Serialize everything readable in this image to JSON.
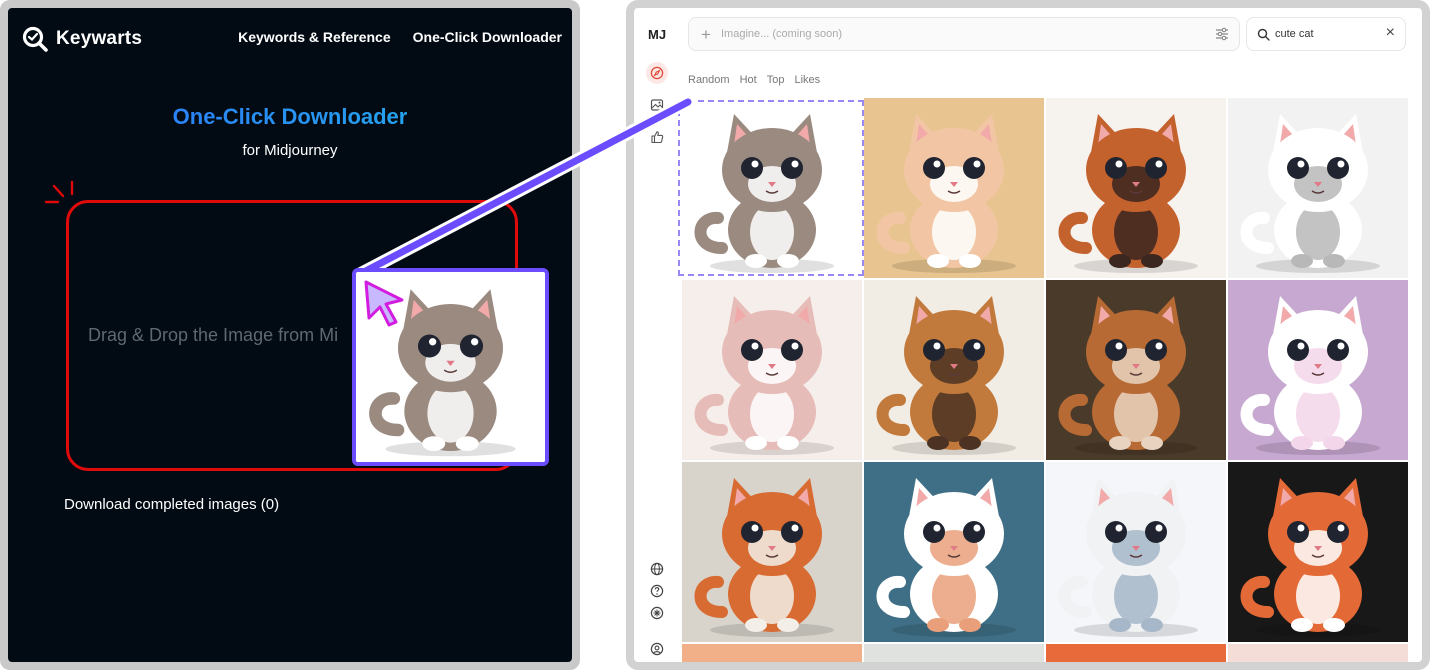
{
  "keywarts": {
    "brand": "Keywarts",
    "nav": [
      "Keywords & Reference",
      "One-Click Downloader"
    ],
    "title": "One-Click Downloader",
    "subtitle": "for Midjourney",
    "drop_text": "Drag & Drop the Image from Mi",
    "download_completed": "Download completed images (0)",
    "accent_gradient": [
      "#2f6dff",
      "#21b8e6"
    ],
    "drop_border_color": "#e10a0a",
    "drag_border_color": "#6b4dff"
  },
  "midjourney": {
    "logo": "MJ",
    "imagine_placeholder": "Imagine... (coming soon)",
    "search_value": "cute cat",
    "tabs": [
      "Random",
      "Hot",
      "Top",
      "Likes"
    ],
    "side_icons_top": [
      "compass-icon",
      "image-icon",
      "thumbs-up-icon"
    ],
    "side_icons_bottom": [
      "globe-icon",
      "help-icon",
      "sun-icon",
      "account-icon"
    ]
  },
  "gallery": {
    "tiles": [
      {
        "bg": "#ffffff",
        "fur": "#9a8a80",
        "accent": "#ffffff"
      },
      {
        "bg": "#e8c590",
        "fur": "#f2c6a4",
        "accent": "#ffffff"
      },
      {
        "bg": "#f6f2ee",
        "fur": "#c4622e",
        "accent": "#3b2620"
      },
      {
        "bg": "#f2f2f2",
        "fur": "#ffffff",
        "accent": "#b8b8b8"
      },
      {
        "bg": "#f6eeea",
        "fur": "#e6bcb8",
        "accent": "#ffffff"
      },
      {
        "bg": "#f1ece4",
        "fur": "#c27a3c",
        "accent": "#4b3222"
      },
      {
        "bg": "#4a3a2a",
        "fur": "#b86a34",
        "accent": "#e7d3c0"
      },
      {
        "bg": "#c6a8d0",
        "fur": "#ffffff",
        "accent": "#f3d6ea"
      },
      {
        "bg": "#d8d4cc",
        "fur": "#d86b32",
        "accent": "#f3efe8"
      },
      {
        "bg": "#3f6f86",
        "fur": "#ffffff",
        "accent": "#e9a07a"
      },
      {
        "bg": "#f4f6fa",
        "fur": "#f0f2f4",
        "accent": "#a5b7c8"
      },
      {
        "bg": "#181818",
        "fur": "#e36a36",
        "accent": "#ffffff"
      }
    ],
    "strip_colors": [
      "#f2b088",
      "#e0e2e0",
      "#e86a3a",
      "#f4ddd6"
    ]
  }
}
